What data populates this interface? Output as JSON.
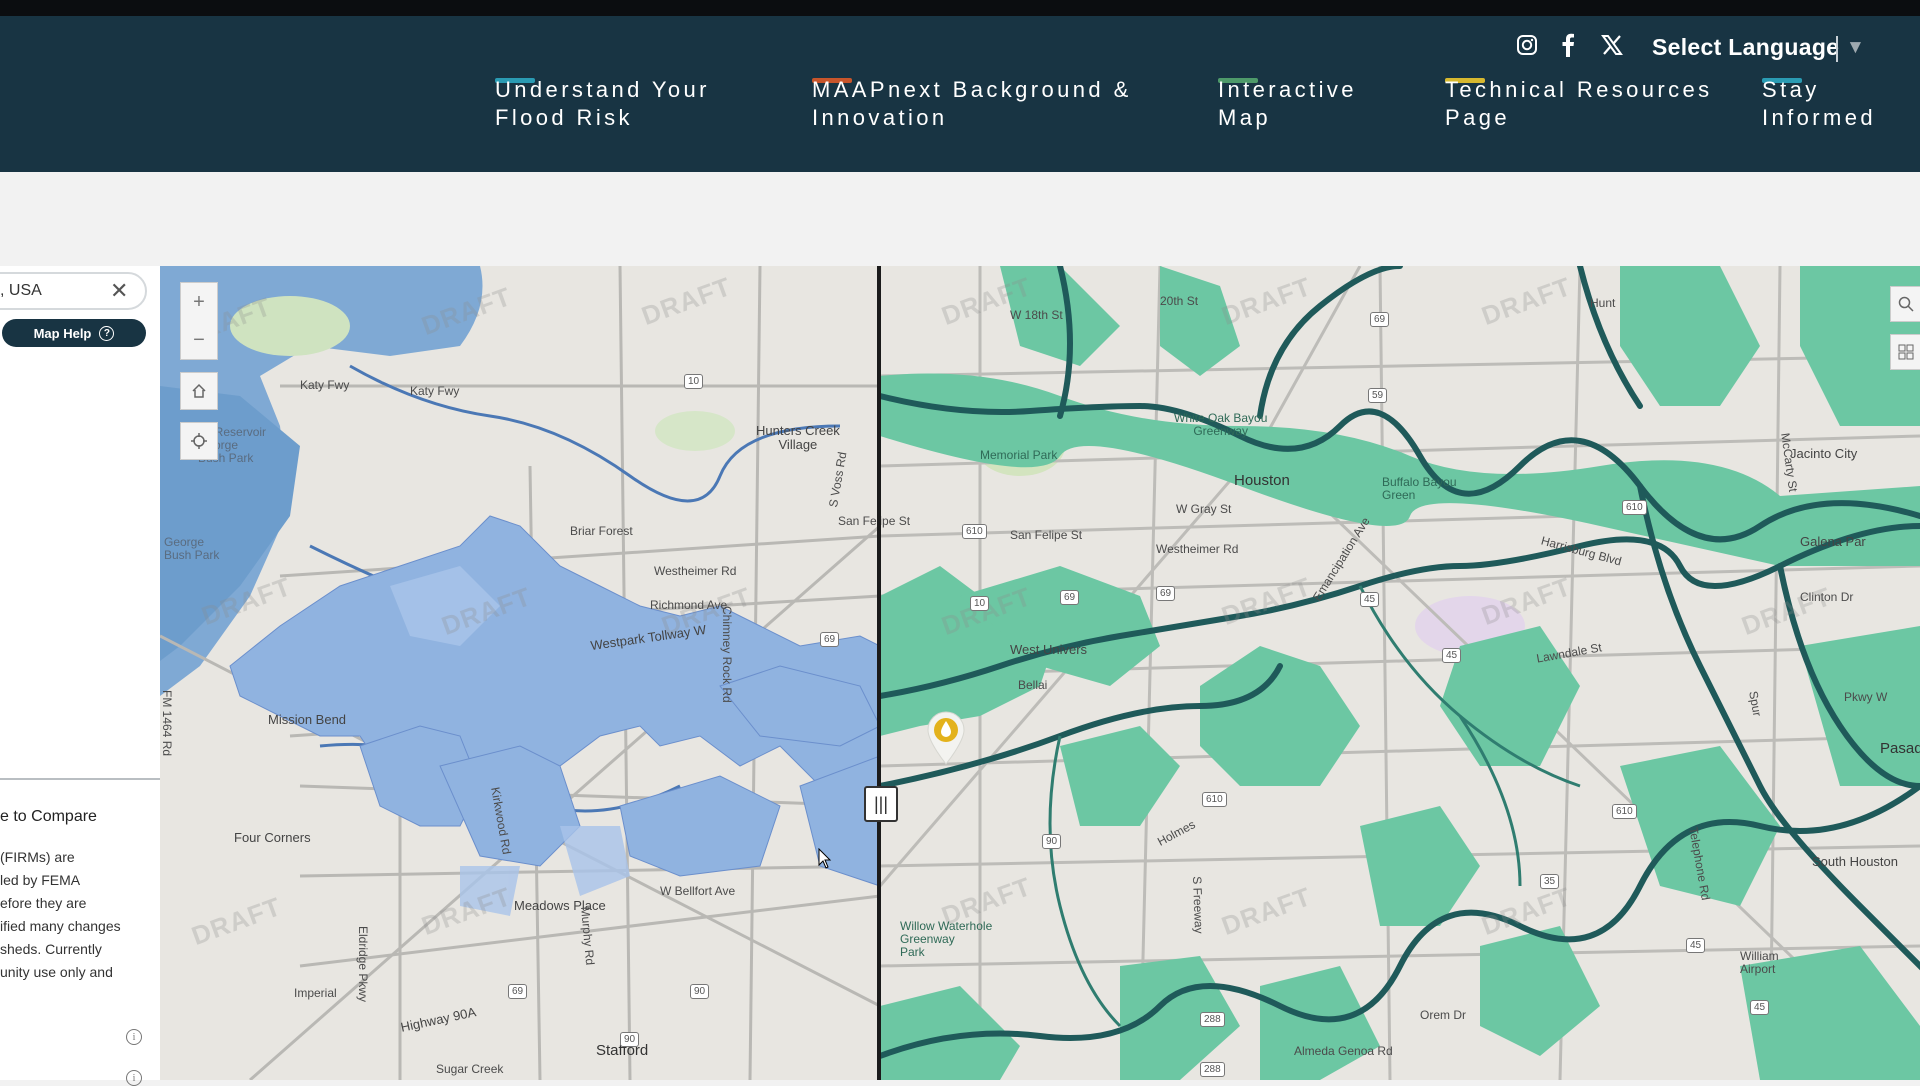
{
  "header": {
    "select_language": "Select Language",
    "social_icons": [
      "instagram-icon",
      "facebook-icon",
      "x-icon"
    ],
    "nav": [
      {
        "label": "Understand Your\nFlood Risk",
        "accent": "#2a9bb3"
      },
      {
        "label": "MAAPnext Background &\nInnovation",
        "accent": "#c7552b"
      },
      {
        "label": "Interactive\nMap",
        "accent": "#4e9a6a"
      },
      {
        "label": "Technical Resources\nPage",
        "accent": "#d6b82f"
      },
      {
        "label": "Stay\nInformed",
        "accent": "#2a9bb3"
      }
    ]
  },
  "left_panel": {
    "search_value": ", USA",
    "map_help": "Map Help",
    "compare_heading": "e to Compare",
    "compare_lines": [
      "(FIRMs) are",
      "led by FEMA",
      "efore they are",
      "ified many changes",
      "sheds. Currently",
      "unity use only and"
    ]
  },
  "map": {
    "watermark": "DRAFT",
    "left_labels": {
      "katy_fwy_1": "Katy Fwy",
      "katy_fwy_2": "Katy Fwy",
      "hunters_creek": "Hunters Creek\nVillage",
      "briar_forest": "Briar Forest",
      "san_felipe": "San Felipe St",
      "westheimer": "Westheimer Rd",
      "richmond": "Richmond Ave",
      "westpark": "Westpark Tollway W",
      "mission_bend": "Mission Bend",
      "four_corners": "Four Corners",
      "meadows_place": "Meadows Place",
      "bellfort": "W Bellfort Ave",
      "imperial": "Imperial",
      "highway_90a": "Highway 90A",
      "stafford": "Stafford",
      "sugar_creek": "Sugar Creek",
      "barker": "on Reservoir\nGeorge\nBush Park",
      "george_bush_park": "George\nBush Park",
      "chimney_rock": "Chimney Rock Rd",
      "voss": "S Voss Rd",
      "fm1464": "FM 1464 Rd",
      "eldridge": "Eldridge Pkwy",
      "kirkwood": "Kirkwood Rd",
      "murphy": "Murphy Rd"
    },
    "right_labels": {
      "w18th": "W 18th St",
      "w20th": "20th St",
      "white_oak": "White Oak Bayou\nGreenway",
      "memorial_park": "Memorial Park",
      "houston": "Houston",
      "w_gray": "W Gray St",
      "san_felipe": "San Felipe St",
      "westheimer": "Westheimer Rd",
      "buffalo_bayou": "Buffalo Bayou\nGreen",
      "emancipation": "Emancipation Ave",
      "harrisburg": "Harrisburg Blvd",
      "west_university": "West Univers",
      "bellaire": "Bellai",
      "lawndale": "Lawndale St",
      "holmes": "Holmes",
      "s_freeway": "S Freeway",
      "willow_waterhole": "Willow Waterhole\nGreenway\nPark",
      "orem": "Orem Dr",
      "almeda_genoa": "Almeda Genoa Rd",
      "jacinto_city": "Jacinto City",
      "galena_park": "Galena Par",
      "clinton": "Clinton Dr",
      "pasadena": "Pasadena",
      "south_houston": "South Houston",
      "william_airport": "William\nAirport",
      "mccarty": "McCarty St",
      "telephone": "Telephone Rd",
      "spur": "Spur",
      "sh225": "Pkwy W",
      "huntington": "Hunt"
    },
    "shields": [
      "10",
      "10",
      "69",
      "59",
      "610",
      "610",
      "69",
      "69",
      "45",
      "45",
      "69",
      "90",
      "90",
      "610",
      "288",
      "288",
      "35",
      "45",
      "45",
      "610",
      "69",
      "90"
    ]
  }
}
